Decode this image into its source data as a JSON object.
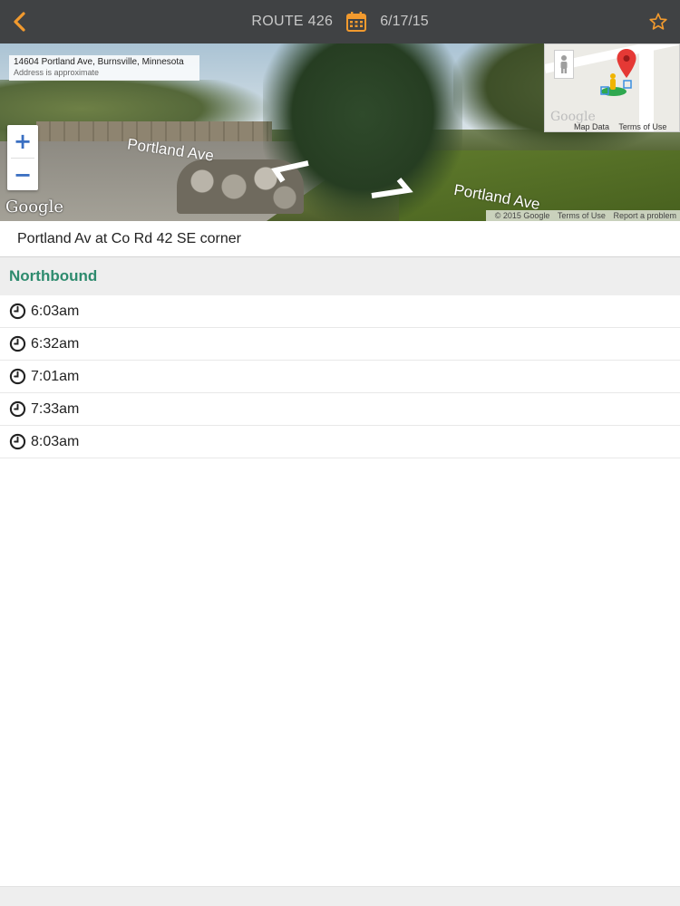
{
  "header": {
    "route_title": "ROUTE 426",
    "date": "6/17/15",
    "accent_color": "#f29a2e",
    "icons": [
      "chevron-left-icon",
      "calendar-icon",
      "star-outline-icon"
    ]
  },
  "streetview": {
    "address": "14604 Portland Ave, Burnsville, Minnesota",
    "address_note": "Address is approximate",
    "road_label_1": "Portland Ave",
    "road_label_2": "Portland Ave",
    "zoom_in": "+",
    "zoom_out": "−",
    "google": "Google",
    "minimap_google": "Google",
    "minimap_map_data": "Map Data",
    "minimap_terms": "Terms of Use",
    "copyright": "© 2015 Google",
    "terms": "Terms of Use",
    "report": "Report a problem"
  },
  "stop": {
    "name": "Portland Av at Co Rd 42 SE corner"
  },
  "direction": {
    "label": "Northbound",
    "color": "#2e8b6e"
  },
  "times": [
    "6:03am",
    "6:32am",
    "7:01am",
    "7:33am",
    "8:03am"
  ]
}
